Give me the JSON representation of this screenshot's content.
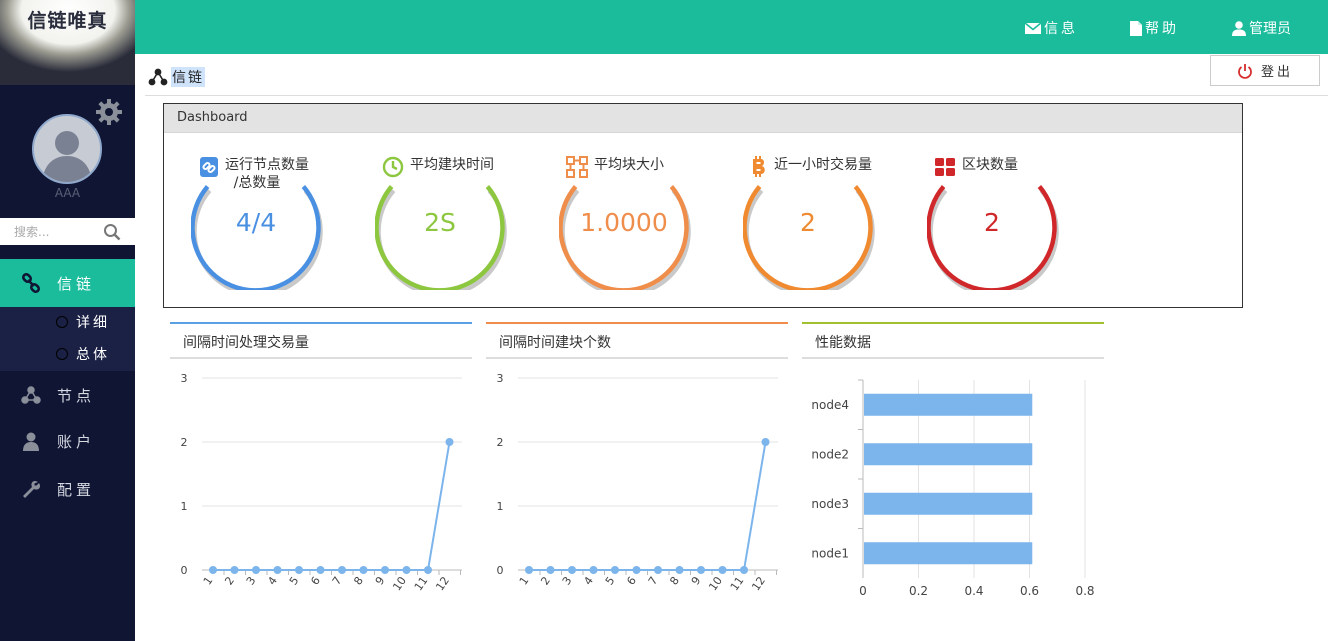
{
  "sidebar": {
    "logo": "信链唯真",
    "user_name": "AAA",
    "search_placeholder": "搜索...",
    "nav": [
      {
        "label": "信链",
        "icon": "chain-link-icon",
        "active": true
      },
      {
        "label": "节点",
        "icon": "network-nodes-icon"
      },
      {
        "label": "账户",
        "icon": "user-icon"
      },
      {
        "label": "配置",
        "icon": "wrench-icon"
      }
    ],
    "submenu": [
      {
        "label": "详细"
      },
      {
        "label": "总体"
      }
    ]
  },
  "topbar": {
    "items": [
      {
        "label": "信息",
        "icon": "envelope-icon"
      },
      {
        "label": "帮助",
        "icon": "document-icon"
      },
      {
        "label": "管理员",
        "icon": "user-icon"
      }
    ],
    "logout_label": "登出"
  },
  "breadcrumb": {
    "label": "信链",
    "icon": "share-nodes-icon"
  },
  "colors": {
    "accent": "#1abc9c",
    "sidebar": "#0f1533",
    "bar": "#7cb4ec"
  },
  "dashboard": {
    "title": "Dashboard",
    "stats": [
      {
        "title": "运行节点数量",
        "title2": "/总数量",
        "value": "4/4",
        "color": "#4a90e2",
        "icon": "link-icon"
      },
      {
        "title": "平均建块时间",
        "value": "2S",
        "color": "#8dc63f",
        "icon": "clock-icon"
      },
      {
        "title": "平均块大小",
        "value": "1.0000",
        "color": "#ef8d4b",
        "icon": "sitemap-icon"
      },
      {
        "title": "近一小时交易量",
        "value": "2",
        "color": "#f08a30",
        "icon": "bitcoin-icon"
      },
      {
        "title": "区块数量",
        "value": "2",
        "color": "#d0282a",
        "icon": "grid-icon"
      }
    ]
  },
  "panels": [
    {
      "title": "间隔时间处理交易量",
      "accent": "#5aa1e3"
    },
    {
      "title": "间隔时间建块个数",
      "accent": "#ef8d4b"
    },
    {
      "title": "性能数据",
      "accent": "#a0c030"
    }
  ],
  "chart_data": [
    {
      "type": "line",
      "x": [
        "1",
        "2",
        "3",
        "4",
        "5",
        "6",
        "7",
        "8",
        "9",
        "10",
        "11",
        "12"
      ],
      "series": [
        {
          "values": [
            0,
            0,
            0,
            0,
            0,
            0,
            0,
            0,
            0,
            0,
            0,
            2
          ]
        }
      ],
      "yticks": [
        "0",
        "1",
        "2",
        "3"
      ],
      "ylim": [
        0,
        3
      ],
      "grid": true
    },
    {
      "type": "line",
      "x": [
        "1",
        "2",
        "3",
        "4",
        "5",
        "6",
        "7",
        "8",
        "9",
        "10",
        "11",
        "12"
      ],
      "series": [
        {
          "values": [
            0,
            0,
            0,
            0,
            0,
            0,
            0,
            0,
            0,
            0,
            0,
            2
          ]
        }
      ],
      "yticks": [
        "0",
        "1",
        "2",
        "3"
      ],
      "ylim": [
        0,
        3
      ],
      "grid": true
    },
    {
      "type": "bar",
      "orientation": "horizontal",
      "categories": [
        "node4",
        "node2",
        "node3",
        "node1"
      ],
      "values": [
        0.61,
        0.61,
        0.61,
        0.61
      ],
      "xticks": [
        "0",
        "0.2",
        "0.4",
        "0.6",
        "0.8"
      ],
      "xlim": [
        0,
        0.8
      ],
      "grid": true
    }
  ]
}
